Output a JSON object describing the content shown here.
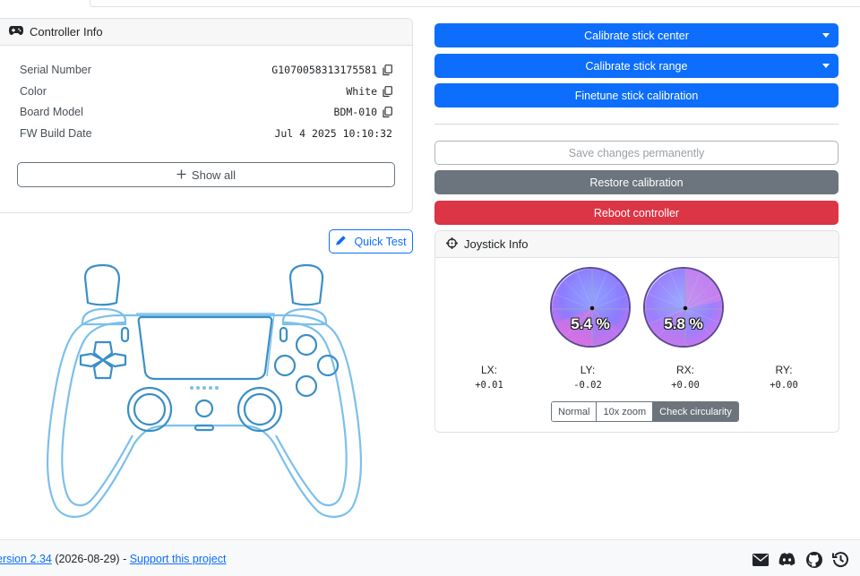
{
  "controller_info": {
    "title": "Controller Info",
    "rows": [
      {
        "label": "Serial Number",
        "value": "G1070058313175581",
        "copyable": true
      },
      {
        "label": "Color",
        "value": "White",
        "copyable": true
      },
      {
        "label": "Board Model",
        "value": "BDM-010",
        "copyable": true
      },
      {
        "label": "FW Build Date",
        "value": "Jul 4 2025 10:10:32",
        "copyable": false
      }
    ],
    "show_all_label": "Show all"
  },
  "quick_test_label": "Quick Test",
  "actions": {
    "calibrate_center": "Calibrate stick center",
    "calibrate_range": "Calibrate stick range",
    "finetune": "Finetune stick calibration",
    "save": "Save changes permanently",
    "restore": "Restore calibration",
    "reboot": "Reboot controller"
  },
  "joystick_info": {
    "title": "Joystick Info",
    "left_stick_circularity": "5.4 %",
    "right_stick_circularity": "5.8 %",
    "axes": [
      {
        "label": "LX:",
        "value": "+0.01"
      },
      {
        "label": "LY:",
        "value": "-0.02"
      },
      {
        "label": "RX:",
        "value": "+0.00"
      },
      {
        "label": "RY:",
        "value": "+0.00"
      }
    ],
    "modes": [
      "Normal",
      "10x zoom",
      "Check circularity"
    ],
    "active_mode": "Check circularity"
  },
  "footer": {
    "version_link": "ersion 2.34",
    "date_text": " (2026-08-29) - ",
    "support_link": "Support this project",
    "icons": [
      "mail-icon",
      "discord-icon",
      "github-icon",
      "history-icon"
    ]
  },
  "colors": {
    "primary": "#0d6efd",
    "secondary": "#6c757d",
    "danger": "#dc3545",
    "controller_outline": "#3a8fc7"
  }
}
